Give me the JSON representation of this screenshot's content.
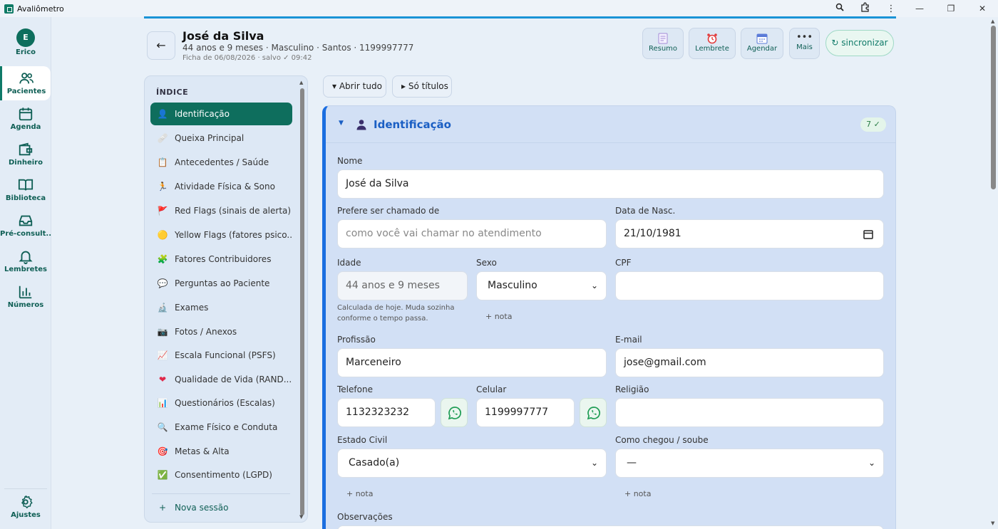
{
  "window": {
    "title": "Avaliômetro"
  },
  "rail": {
    "user_initial": "E",
    "user_label": "Erico",
    "items": [
      {
        "label": "Pacientes"
      },
      {
        "label": "Agenda"
      },
      {
        "label": "Dinheiro"
      },
      {
        "label": "Biblioteca"
      },
      {
        "label": "Pré-consult..."
      },
      {
        "label": "Lembretes"
      },
      {
        "label": "Números"
      }
    ],
    "settings_label": "Ajustes"
  },
  "header": {
    "back_glyph": "←",
    "patient_name": "José da Silva",
    "patient_info": "44 anos e 9 meses · Masculino · Santos · 1199997777",
    "saved_info": "Ficha de 06/08/2026 · salvo ✓ 09:42",
    "actions": {
      "resumo": "Resumo",
      "lembrete": "Lembrete",
      "agendar": "Agendar",
      "mais": "Mais"
    },
    "sync_label": "↻ sincronizar"
  },
  "index": {
    "title": "ÍNDICE",
    "items": [
      {
        "icon": "👤",
        "label": "Identificação"
      },
      {
        "icon": "🩹",
        "label": "Queixa Principal"
      },
      {
        "icon": "📋",
        "label": "Antecedentes / Saúde"
      },
      {
        "icon": "🏃",
        "label": "Atividade Física & Sono"
      },
      {
        "icon": "🚩",
        "label": "Red Flags (sinais de alerta)"
      },
      {
        "icon": "🟡",
        "label": "Yellow Flags (fatores psico..."
      },
      {
        "icon": "🧩",
        "label": "Fatores Contribuidores"
      },
      {
        "icon": "💬",
        "label": "Perguntas ao Paciente"
      },
      {
        "icon": "🔬",
        "label": "Exames"
      },
      {
        "icon": "📷",
        "label": "Fotos / Anexos"
      },
      {
        "icon": "📈",
        "label": "Escala Funcional (PSFS)"
      },
      {
        "icon": "❤",
        "label": "Qualidade de Vida (RAND..."
      },
      {
        "icon": "📊",
        "label": "Questionários (Escalas)"
      },
      {
        "icon": "🔍",
        "label": "Exame Físico e Conduta"
      },
      {
        "icon": "🎯",
        "label": "Metas & Alta"
      },
      {
        "icon": "✅",
        "label": "Consentimento (LGPD)"
      }
    ],
    "new_session_icon": "+",
    "new_session": "Nova sessão"
  },
  "toolbar": {
    "open_all": "▾  Abrir tudo",
    "titles_only": "▸  Só títulos"
  },
  "section": {
    "title": "Identificação",
    "badge": "7 ✓",
    "fields": {
      "nome": {
        "label": "Nome",
        "value": "José da Silva"
      },
      "apelido": {
        "label": "Prefere ser chamado de",
        "placeholder": "como você vai chamar no atendimento"
      },
      "nascimento": {
        "label": "Data de Nasc.",
        "value": "21/10/1981"
      },
      "idade": {
        "label": "Idade",
        "value": "44 anos e 9 meses",
        "hint1": "Calculada de hoje. Muda sozinha",
        "hint2": "conforme o tempo passa."
      },
      "sexo": {
        "label": "Sexo",
        "value": "Masculino"
      },
      "cpf": {
        "label": "CPF",
        "value": ""
      },
      "profissao": {
        "label": "Profissão",
        "value": "Marceneiro"
      },
      "email": {
        "label": "E-mail",
        "value": "jose@gmail.com"
      },
      "telefone": {
        "label": "Telefone",
        "value": "1132323232"
      },
      "celular": {
        "label": "Celular",
        "value": "1199997777"
      },
      "religiao": {
        "label": "Religião",
        "value": ""
      },
      "estado_civil": {
        "label": "Estado Civil",
        "value": "Casado(a)"
      },
      "como_chegou": {
        "label": "Como chegou / soube",
        "value": "—"
      },
      "observacoes": {
        "label": "Observações"
      }
    },
    "note_label": "+  nota"
  },
  "colors": {
    "accent": "#0e6e5d",
    "section_blue": "#1b5fc4",
    "card_bg": "#d2e0f5"
  }
}
